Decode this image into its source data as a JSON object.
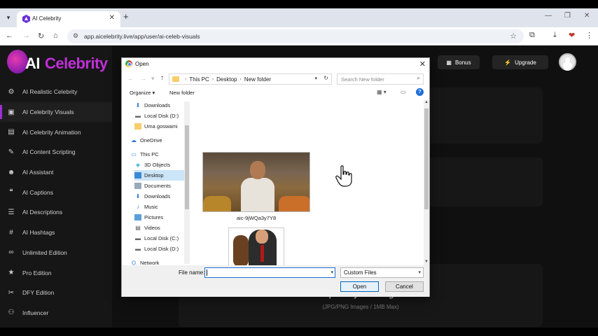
{
  "browser": {
    "tab_title": "AI Celebrity",
    "url": "app.aicelebrity.live/app/user/ai-celeb-visuals"
  },
  "app": {
    "logo_ai": "AI",
    "logo_rest": "Celebrity",
    "bonus_label": "Bonus",
    "upgrade_label": "Upgrade",
    "upload_title": "Upload your image",
    "upload_hint": "(JPG/PNG Images / 1MB Max)",
    "brand_color": "#c02fd8",
    "sidebar": [
      {
        "label": "AI Realistic Celebrity",
        "icon": "gear-icon"
      },
      {
        "label": "AI Celebrity Visuals",
        "icon": "image-icon",
        "active": true
      },
      {
        "label": "AI Celebrity Animation",
        "icon": "film-icon"
      },
      {
        "label": "AI Content Scripting",
        "icon": "pen-icon"
      },
      {
        "label": "AI Assistant",
        "icon": "person-icon"
      },
      {
        "label": "AI Captions",
        "icon": "quote-icon"
      },
      {
        "label": "AI Descriptions",
        "icon": "lines-icon"
      },
      {
        "label": "AI Hashtags",
        "icon": "hash-icon"
      },
      {
        "label": "Unlimited Edition",
        "icon": "infinity-icon"
      },
      {
        "label": "Pro Edition",
        "icon": "star-icon"
      },
      {
        "label": "DFY Edition",
        "icon": "tools-icon"
      },
      {
        "label": "Influencer",
        "icon": "group-icon"
      }
    ]
  },
  "dialog": {
    "title": "Open",
    "breadcrumb": [
      "This PC",
      "Desktop",
      "New folder"
    ],
    "search_placeholder": "Search New folder",
    "organize_label": "Organize",
    "new_folder_label": "New folder",
    "tree": [
      {
        "label": "Downloads",
        "icon": "download-icon"
      },
      {
        "label": "Local Disk (D:)",
        "icon": "disk-icon"
      },
      {
        "label": "Uma goswami",
        "icon": "folder-icon"
      },
      {
        "label": "OneDrive",
        "icon": "cloud-icon"
      },
      {
        "label": "This PC",
        "icon": "pc-icon"
      },
      {
        "label": "3D Objects",
        "icon": "cube-icon"
      },
      {
        "label": "Desktop",
        "icon": "desktop-icon",
        "selected": true
      },
      {
        "label": "Documents",
        "icon": "documents-icon"
      },
      {
        "label": "Downloads",
        "icon": "download-icon"
      },
      {
        "label": "Music",
        "icon": "music-icon"
      },
      {
        "label": "Pictures",
        "icon": "pictures-icon"
      },
      {
        "label": "Videos",
        "icon": "videos-icon"
      },
      {
        "label": "Local Disk (C:)",
        "icon": "disk-icon"
      },
      {
        "label": "Local Disk (D:)",
        "icon": "disk-icon"
      },
      {
        "label": "Network",
        "icon": "network-icon"
      }
    ],
    "files": [
      {
        "name": "aic-9jWQa3y7Y8"
      }
    ],
    "file_name_label": "File name:",
    "file_name_value": "",
    "file_type": "Custom Files",
    "open_label": "Open",
    "cancel_label": "Cancel"
  }
}
